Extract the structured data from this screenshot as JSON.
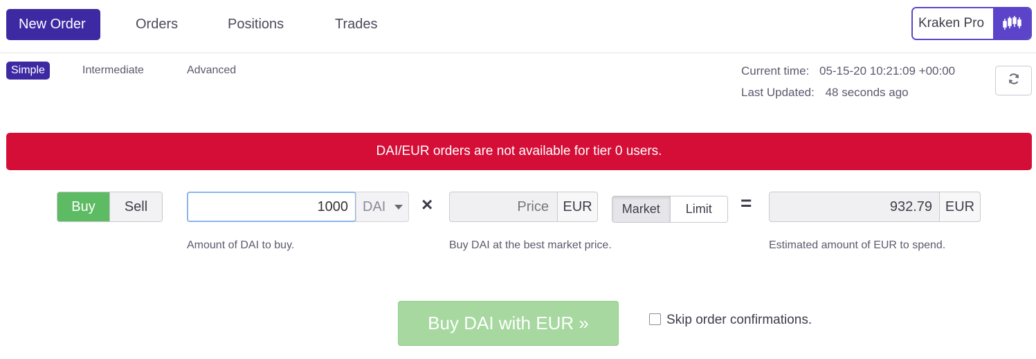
{
  "topnav": {
    "tabs": [
      {
        "label": "New Order",
        "active": true
      },
      {
        "label": "Orders",
        "active": false
      },
      {
        "label": "Positions",
        "active": false
      },
      {
        "label": "Trades",
        "active": false
      }
    ],
    "kraken_pro_label": "Kraken Pro",
    "kraken_pro_icon": "candlestick-chart-icon"
  },
  "subtabs": [
    {
      "label": "Simple",
      "active": true
    },
    {
      "label": "Intermediate",
      "active": false
    },
    {
      "label": "Advanced",
      "active": false
    }
  ],
  "status": {
    "current_time_label": "Current time:",
    "current_time_value": "05-15-20 10:21:09 +00:00",
    "last_updated_label": "Last Updated:",
    "last_updated_value": "48 seconds ago",
    "refresh_icon": "refresh-icon"
  },
  "alert": {
    "message": "DAI/EUR orders are not available for tier 0 users.",
    "color": "#d40e37"
  },
  "order": {
    "side_options": [
      "Buy",
      "Sell"
    ],
    "side_selected": "Buy",
    "amount_value": "1000",
    "amount_currency": "DAI",
    "times_symbol": "×",
    "price_placeholder": "Price",
    "price_currency": "EUR",
    "type_options": [
      "Market",
      "Limit"
    ],
    "type_selected": "Market",
    "equals_symbol": "=",
    "estimate_value": "932.79",
    "estimate_currency": "EUR",
    "hint_amount": "Amount of DAI to buy.",
    "hint_price": "Buy DAI at the best market price.",
    "hint_estimate": "Estimated amount of EUR to spend.",
    "submit_label": "Buy DAI with EUR »",
    "skip_label": "Skip order confirmations.",
    "skip_checked": false
  },
  "colors": {
    "brand_purple": "#3d2aa3",
    "buy_green": "#5dbb63",
    "submit_disabled_green": "#a6d8a0"
  }
}
